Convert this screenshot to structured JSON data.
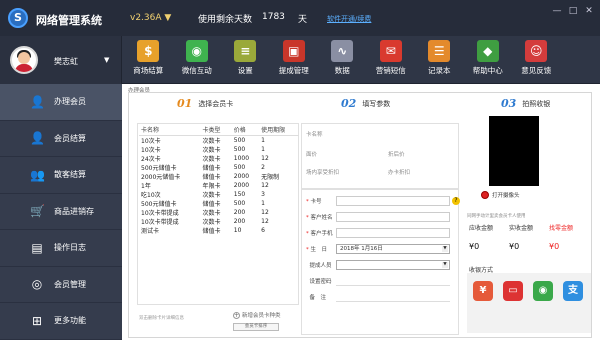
{
  "app": {
    "title": "网络管理系统",
    "logo_letter": "S",
    "version": "v2.36A",
    "version_caret": "▼",
    "days_label": "使用剩余天数",
    "days_value": "1783",
    "days_unit": "天",
    "renew_link": "软件开通/续费"
  },
  "window_buttons": [
    "—",
    "□",
    "✕"
  ],
  "user": {
    "name": "樊志虹",
    "caret": "▼"
  },
  "toolbar": [
    {
      "label": "商场结算",
      "icon": "dollar-icon",
      "glyph": "$",
      "color": "#e7a12b"
    },
    {
      "label": "微信互动",
      "icon": "wechat-icon",
      "glyph": "◉",
      "color": "#3fb34f"
    },
    {
      "label": "设置",
      "icon": "settings-icon",
      "glyph": "≡",
      "color": "#9aa93a"
    },
    {
      "label": "提成管理",
      "icon": "commission-icon",
      "glyph": "▣",
      "color": "#c9362a"
    },
    {
      "label": "数据",
      "icon": "chart-icon",
      "glyph": "∿",
      "color": "#8a8fa3"
    },
    {
      "label": "营销短信",
      "icon": "sms-icon",
      "glyph": "✉",
      "color": "#d93a2e"
    },
    {
      "label": "记录本",
      "icon": "notebook-icon",
      "glyph": "☰",
      "color": "#e48a2c"
    },
    {
      "label": "帮助中心",
      "icon": "help-icon",
      "glyph": "◆",
      "color": "#3f9e41"
    },
    {
      "label": "意见反馈",
      "icon": "feedback-icon",
      "glyph": "☺",
      "color": "#d43c3c"
    }
  ],
  "sidenav": [
    {
      "label": "办理会员",
      "icon": "member-add-icon",
      "glyph": "👤",
      "active": true
    },
    {
      "label": "会员结算",
      "icon": "member-checkout-icon",
      "glyph": "👤",
      "active": false
    },
    {
      "label": "散客结算",
      "icon": "guest-checkout-icon",
      "glyph": "👥",
      "active": false
    },
    {
      "label": "商品进销存",
      "icon": "cart-icon",
      "glyph": "🛒",
      "active": false
    },
    {
      "label": "操作日志",
      "icon": "log-icon",
      "glyph": "▤",
      "active": false
    },
    {
      "label": "会员管理",
      "icon": "member-manage-icon",
      "glyph": "◎",
      "active": false
    },
    {
      "label": "更多功能",
      "icon": "more-icon",
      "glyph": "⊞",
      "active": false
    }
  ],
  "main": {
    "section_tag": "办理会员",
    "step1": {
      "num": "01",
      "title": "选择会员卡"
    },
    "step2": {
      "num": "02",
      "title": "填写参数"
    },
    "step3": {
      "num": "03",
      "title": "拍照收银"
    },
    "table_headers": [
      "卡名称",
      "卡类型",
      "价格",
      "使用期限"
    ],
    "cards": [
      [
        "10次卡",
        "次数卡",
        "500",
        "1"
      ],
      [
        "10次卡",
        "次数卡",
        "500",
        "1"
      ],
      [
        "24次卡",
        "次数卡",
        "1000",
        "12"
      ],
      [
        "500元储值卡",
        "储值卡",
        "500",
        "2"
      ],
      [
        "2000元储值卡",
        "储值卡",
        "2000",
        "无限制"
      ],
      [
        "1年",
        "年限卡",
        "2000",
        "12"
      ],
      [
        "吃10次",
        "次数卡",
        "150",
        "3"
      ],
      [
        "500元储值卡",
        "储值卡",
        "500",
        "1"
      ],
      [
        "10次卡带提成",
        "次数卡",
        "200",
        "12"
      ],
      [
        "10次卡带提成",
        "次数卡",
        "200",
        "12"
      ],
      [
        "测试卡",
        "储值卡",
        "10",
        "6"
      ]
    ],
    "hint": "双击删除卡片详细信息",
    "add_card": "新增会员卡种类",
    "sort_button": "会员卡排序",
    "params": {
      "card_name": "卡名称",
      "price": "面价",
      "after_discount": "折后价",
      "venue_discount": "场内享受折扣",
      "card_discount": "办卡折扣"
    },
    "form": {
      "card_no": "卡号",
      "customer_name": "客户姓名",
      "customer_phone": "客户手机",
      "birthday": "生　日",
      "birthday_value": "2018年  1月16日",
      "referrer": "提成人员",
      "password": "设置密码",
      "remark": "备　注"
    },
    "camera_button": "打开摄像头",
    "pay_hint": "同网手动计里卖会员卡人使用",
    "pay": {
      "receivable_label": "应收金额",
      "receivable_value": "¥0",
      "actual_label": "实收金额",
      "actual_value": "¥0",
      "change_label": "找零金额",
      "change_value": "¥0"
    },
    "pay_method_label": "收银方式",
    "pay_methods": [
      {
        "icon": "cash-icon",
        "glyph": "¥",
        "color": "#e55a3a"
      },
      {
        "icon": "card-icon",
        "glyph": "▭",
        "color": "#d33"
      },
      {
        "icon": "wechat-pay-icon",
        "glyph": "◉",
        "color": "#3aa84a"
      },
      {
        "icon": "alipay-icon",
        "glyph": "支",
        "color": "#2f8fe0"
      }
    ]
  }
}
